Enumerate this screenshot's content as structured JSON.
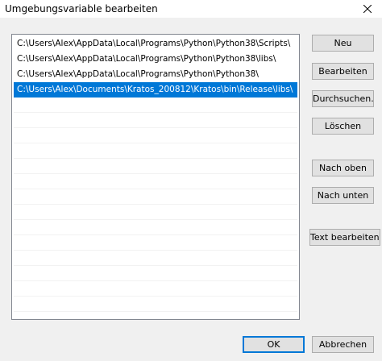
{
  "window": {
    "title": "Umgebungsvariable bearbeiten"
  },
  "paths": [
    "C:\\Users\\Alex\\AppData\\Local\\Programs\\Python\\Python38\\Scripts\\",
    "C:\\Users\\Alex\\AppData\\Local\\Programs\\Python\\Python38\\libs\\",
    "C:\\Users\\Alex\\AppData\\Local\\Programs\\Python\\Python38\\",
    "C:\\Users\\Alex\\Documents\\Kratos_200812\\Kratos\\bin\\Release\\libs\\"
  ],
  "selected_index": 3,
  "buttons": {
    "new": "Neu",
    "edit": "Bearbeiten",
    "browse": "Durchsuchen...",
    "delete": "Löschen",
    "move_up": "Nach oben",
    "move_down": "Nach unten",
    "edit_text": "Text bearbeiten...",
    "ok": "OK",
    "cancel": "Abbrechen"
  },
  "colors": {
    "selection": "#0078d7",
    "dialog_bg": "#f0f0f0"
  },
  "icons": {
    "close": "close-icon"
  }
}
